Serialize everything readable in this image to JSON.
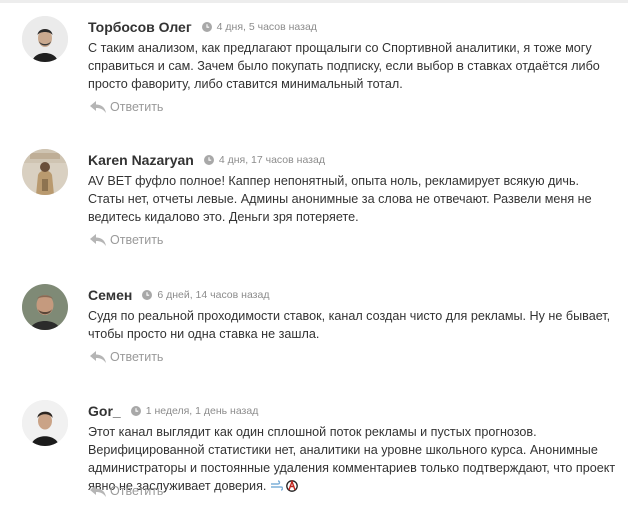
{
  "comments": [
    {
      "author": "Торбосов Олег",
      "time": "4 дня, 5 часов назад",
      "text": "С таким анализом, как предлагают прощалыги со Спортивной аналитики, я тоже могу справиться и сам. Зачем было покупать подписку, если выбор в ставках отдаётся либо просто фавориту, либо ставится минимальный тотал.",
      "reply_label": "Ответить"
    },
    {
      "author": "Karen Nazaryan",
      "time": "4 дня, 17 часов назад",
      "text": "AV BET фуфло полное! Каппер непонятный, опыта ноль, рекламирует всякую дичь. Статы нет, отчеты левые. Админы анонимные за слова не отвечают. Развели меня не ведитесь кидалово это. Деньги зря потеряете.",
      "reply_label": "Ответить"
    },
    {
      "author": "Семен",
      "time": "6 дней, 14 часов назад",
      "text": "Судя по реальной проходимости ставок, канал создан чисто для рекламы. Ну не бывает, чтобы просто ни одна ставка не зашла.",
      "reply_label": "Ответить"
    },
    {
      "author": "Gor_",
      "time": "1 неделя, 1 день назад",
      "text": "Этот канал выглядит как один сплошной поток рекламы и пустых прогнозов. Верифицированной статистики нет, аналитики на уровне школьного курса. Анонимные администраторы и постоянные удаления комментариев только подтверждают, что проект явно не заслуживает доверия.",
      "reply_label": "Ответить"
    }
  ],
  "icons": {
    "clock": "clock-icon",
    "reply": "reply-arrow-icon",
    "emoji": [
      "wind-emoji-icon",
      "anarchy-emoji-icon"
    ]
  },
  "colors": {
    "author": "#333333",
    "meta": "#8c8c8c",
    "reply": "#9a9a9a",
    "reply_icon": "#b5b5b5"
  }
}
